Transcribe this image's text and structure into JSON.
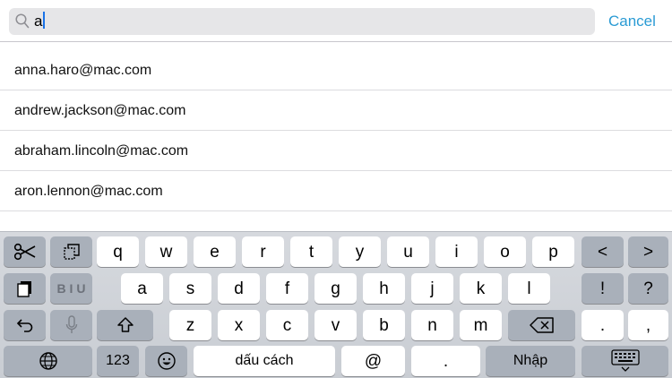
{
  "search": {
    "query": "a",
    "cancel_label": "Cancel"
  },
  "results": [
    "anna.haro@mac.com",
    "andrew.jackson@mac.com",
    "abraham.lincoln@mac.com",
    "aron.lennon@mac.com"
  ],
  "keyboard": {
    "row1": [
      "q",
      "w",
      "e",
      "r",
      "t",
      "y",
      "u",
      "i",
      "o",
      "p"
    ],
    "row1_right": [
      "<",
      ">"
    ],
    "row2": [
      "a",
      "s",
      "d",
      "f",
      "g",
      "h",
      "j",
      "k",
      "l"
    ],
    "row2_right": [
      "!",
      "?"
    ],
    "row3": [
      "z",
      "x",
      "c",
      "v",
      "b",
      "n",
      "m"
    ],
    "row3_right": [
      ".",
      ","
    ],
    "format_label": "B I U",
    "numbers_label": "123",
    "space_label": "dấu cách",
    "at_label": "@",
    "dot_label": ".",
    "return_label": "Nhập"
  },
  "colors": {
    "accent": "#2a9bd4",
    "key_light": "#ffffff",
    "key_dark": "#a9b0ba",
    "keyboard_bg": "#d0d3d8"
  }
}
